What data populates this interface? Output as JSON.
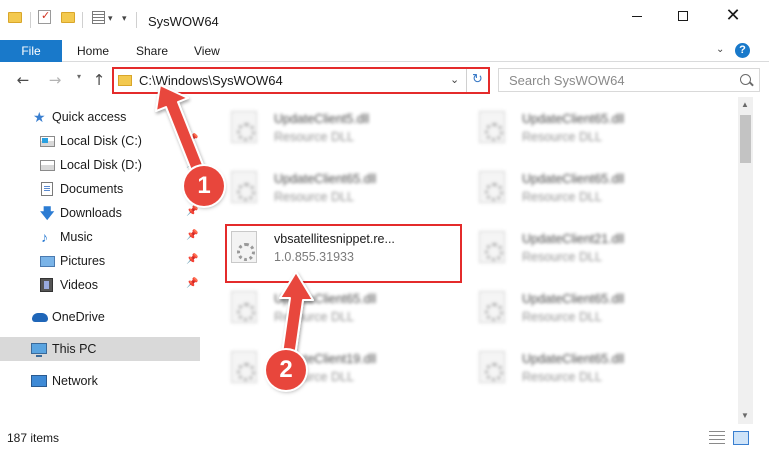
{
  "window": {
    "title": "SysWOW64",
    "minimize_glyph": "",
    "close_glyph": "✕"
  },
  "ribbon": {
    "tabs": [
      "File",
      "Home",
      "Share",
      "View"
    ],
    "help_glyph": "?"
  },
  "address": {
    "path": "C:\\Windows\\SysWOW64",
    "refresh_glyph": "↻"
  },
  "search": {
    "placeholder": "Search SysWOW64"
  },
  "nav_buttons": {
    "back": "←",
    "forward": "→",
    "up": "↑"
  },
  "sidebar": {
    "items": [
      {
        "label": "Quick access",
        "icon": "star-icon",
        "pinned": false
      },
      {
        "label": "Local Disk (C:)",
        "icon": "drive-c-icon",
        "pinned": true
      },
      {
        "label": "Local Disk (D:)",
        "icon": "drive-d-icon",
        "pinned": true
      },
      {
        "label": "Documents",
        "icon": "documents-icon",
        "pinned": true
      },
      {
        "label": "Downloads",
        "icon": "downloads-icon",
        "pinned": true
      },
      {
        "label": "Music",
        "icon": "music-icon",
        "pinned": true
      },
      {
        "label": "Pictures",
        "icon": "pictures-icon",
        "pinned": true
      },
      {
        "label": "Videos",
        "icon": "videos-icon",
        "pinned": true
      },
      {
        "label": "OneDrive",
        "icon": "onedrive-icon",
        "pinned": false
      },
      {
        "label": "This PC",
        "icon": "this-pc-icon",
        "pinned": false,
        "selected": true
      },
      {
        "label": "Network",
        "icon": "network-icon",
        "pinned": false
      }
    ]
  },
  "files": {
    "left_column": [
      {
        "name": "UpdateClient5.dll",
        "type": "Resource DLL"
      },
      {
        "name": "UpdateClient65.dll",
        "type": "Resource DLL"
      },
      {
        "name": "vbsatellitesnippet.re...",
        "type": "1.0.855.31933",
        "highlighted": true
      },
      {
        "name": "UpdateClient65.dll",
        "type": "Resource DLL"
      },
      {
        "name": "UpdateClient19.dll",
        "type": "Resource DLL"
      }
    ],
    "right_column": [
      {
        "name": "UpdateClient65.dll",
        "type": "Resource DLL"
      },
      {
        "name": "UpdateClient65.dll",
        "type": "Resource DLL"
      },
      {
        "name": "UpdateClient21.dll",
        "type": "Resource DLL"
      },
      {
        "name": "UpdateClient65.dll",
        "type": "Resource DLL"
      },
      {
        "name": "UpdateClient65.dll",
        "type": "Resource DLL"
      }
    ]
  },
  "status": {
    "item_count": "187 items"
  },
  "annotations": {
    "step1": "1",
    "step2": "2",
    "color": "#e8463c"
  },
  "colors": {
    "accent": "#1979ca",
    "highlight_border": "#e42b2b"
  }
}
